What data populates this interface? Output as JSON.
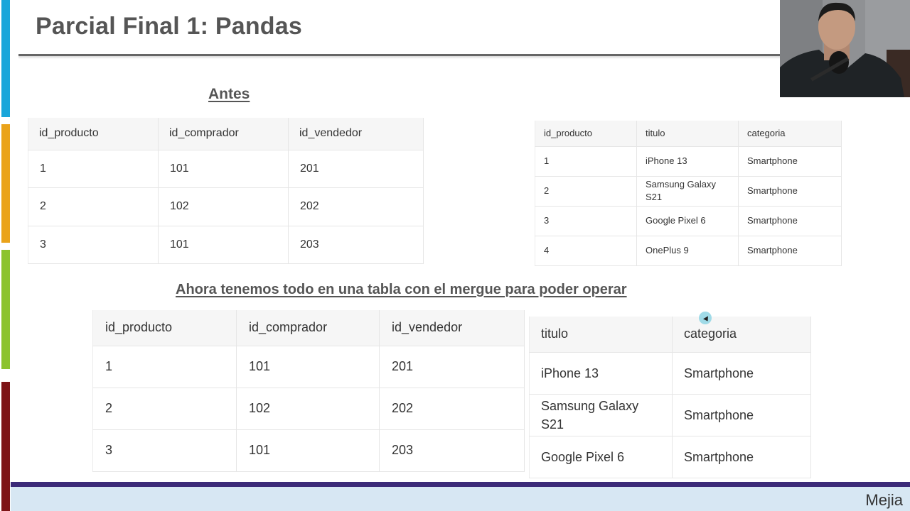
{
  "slide": {
    "title": "Parcial Final 1: Pandas",
    "footer_author": "Mejia"
  },
  "colors": {
    "sidebar_segments": [
      "#19a6da",
      "#eaa31a",
      "#8cc32e",
      "#7d1416"
    ],
    "footer_band": "#3b2a78",
    "footer_background": "#d7e7f3",
    "cursor_highlight": "#96d7e6"
  },
  "section_before": {
    "heading": "Antes",
    "table_orders": {
      "headers": [
        "id_producto",
        "id_comprador",
        "id_vendedor"
      ],
      "rows": [
        [
          "1",
          "101",
          "201"
        ],
        [
          "2",
          "102",
          "202"
        ],
        [
          "3",
          "101",
          "203"
        ]
      ]
    },
    "table_products": {
      "headers": [
        "id_producto",
        "titulo",
        "categoria"
      ],
      "rows": [
        [
          "1",
          "iPhone 13",
          "Smartphone"
        ],
        [
          "2",
          "Samsung Galaxy S21",
          "Smartphone"
        ],
        [
          "3",
          "Google Pixel 6",
          "Smartphone"
        ],
        [
          "4",
          "OnePlus 9",
          "Smartphone"
        ]
      ]
    }
  },
  "section_after": {
    "heading": "Ahora tenemos todo en una tabla con el mergue para poder operar",
    "table_left": {
      "headers": [
        "id_producto",
        "id_comprador",
        "id_vendedor"
      ],
      "rows": [
        [
          "1",
          "101",
          "201"
        ],
        [
          "2",
          "102",
          "202"
        ],
        [
          "3",
          "101",
          "203"
        ]
      ]
    },
    "table_right": {
      "headers": [
        "titulo",
        "categoria"
      ],
      "rows": [
        [
          "iPhone 13",
          "Smartphone"
        ],
        [
          "Samsung Galaxy S21",
          "Smartphone"
        ],
        [
          "Google Pixel 6",
          "Smartphone"
        ]
      ]
    }
  }
}
